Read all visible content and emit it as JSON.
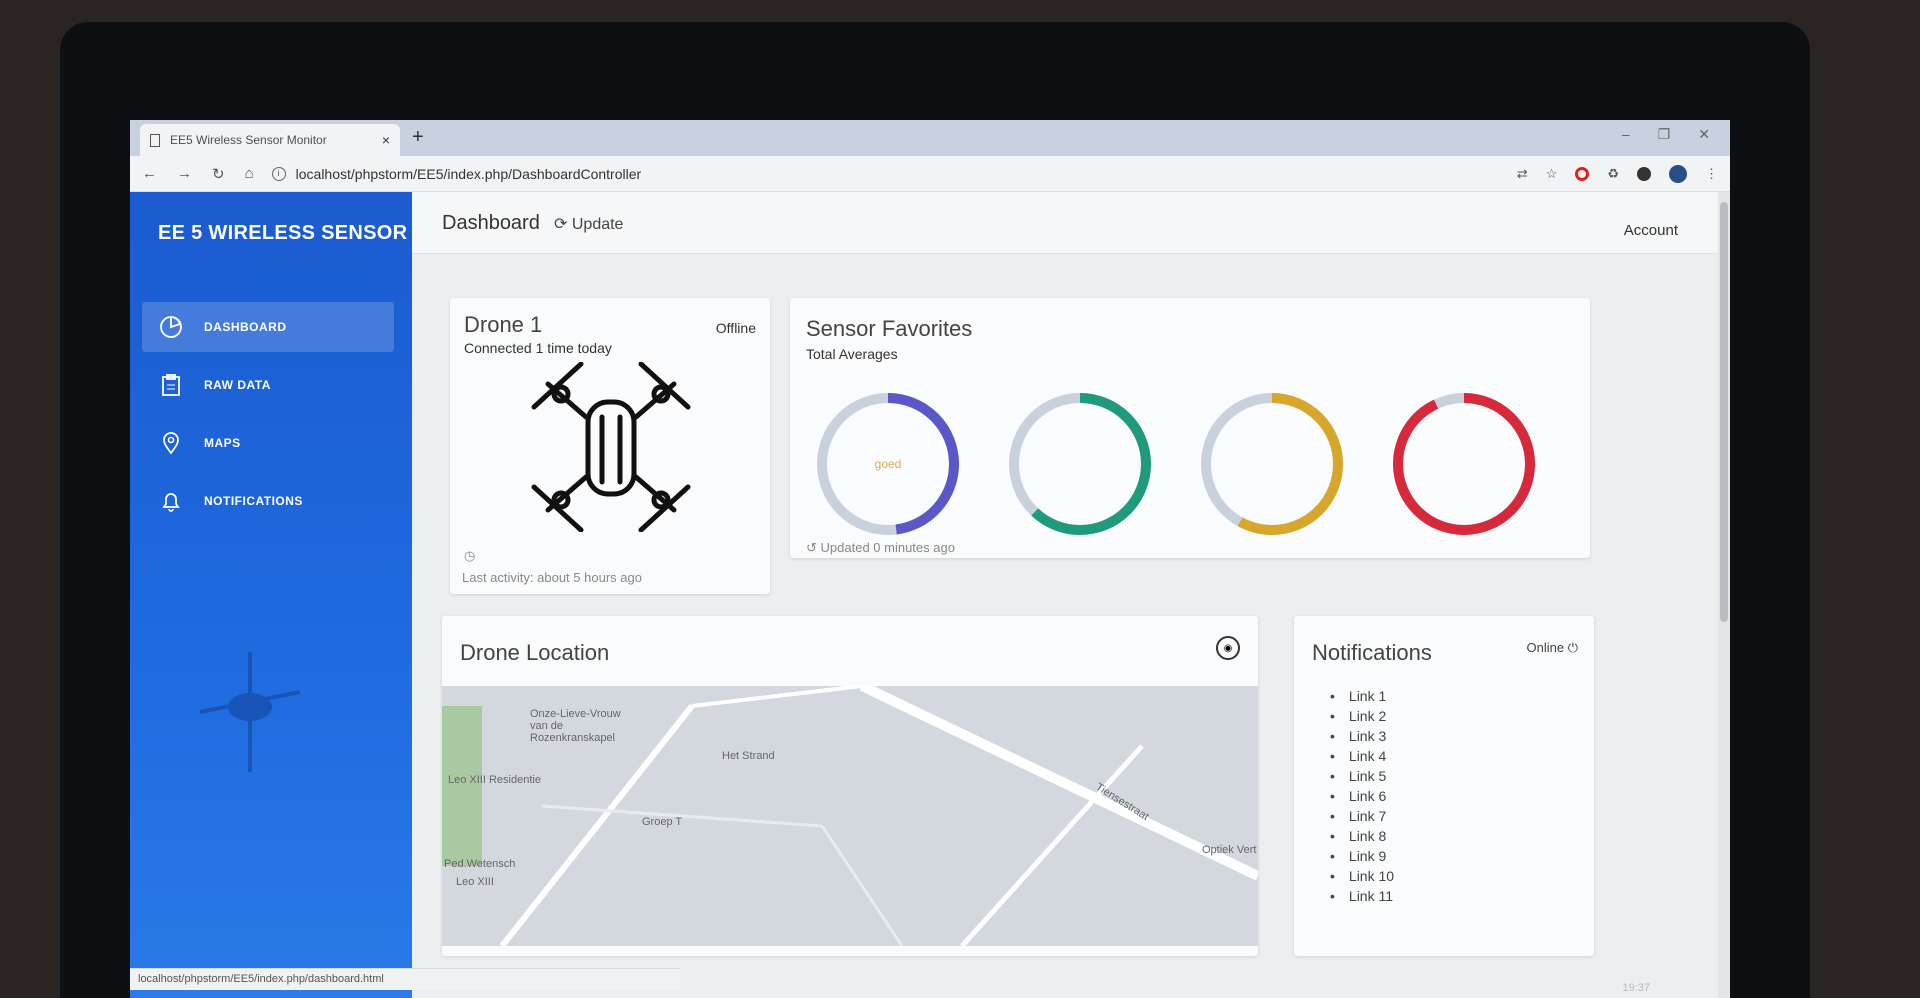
{
  "browser": {
    "tab_title": "EE5 Wireless Sensor Monitor",
    "tab_close": "×",
    "new_tab": "+",
    "url": "localhost/phpstorm/EE5/index.php/DashboardController",
    "status_url": "localhost/phpstorm/EE5/index.php/dashboard.html"
  },
  "sidebar": {
    "brand": "EE 5 WIRELESS SENSOR",
    "items": [
      {
        "label": "DASHBOARD",
        "icon": "dashboard-icon",
        "active": true
      },
      {
        "label": "RAW DATA",
        "icon": "clipboard-icon",
        "active": false
      },
      {
        "label": "MAPS",
        "icon": "map-pin-icon",
        "active": false
      },
      {
        "label": "NOTIFICATIONS",
        "icon": "bell-icon",
        "active": false
      }
    ]
  },
  "header": {
    "title": "Dashboard",
    "update_label": "Update",
    "account_label": "Account"
  },
  "drone_card": {
    "title": "Drone 1",
    "status": "Offline",
    "connected": "Connected 1 time today",
    "last_activity": "Last activity: about 5 hours ago"
  },
  "sensor_card": {
    "title": "Sensor Favorites",
    "subtitle": "Total Averages",
    "updated": "Updated 0 minutes ago",
    "rings": [
      {
        "color": "#5b57c8",
        "fraction": 0.48,
        "center_label": "goed"
      },
      {
        "color": "#1f9a7c",
        "fraction": 0.62,
        "center_label": ""
      },
      {
        "color": "#d6a72a",
        "fraction": 0.58,
        "center_label": ""
      },
      {
        "color": "#d62a3c",
        "fraction": 0.93,
        "center_label": ""
      }
    ]
  },
  "location_card": {
    "title": "Drone Location",
    "map_labels": [
      "Onze-Lieve-Vrouw van de Rozenkranskapel",
      "Het Strand",
      "Leo XIII Residentie",
      "Groep T",
      "Ped.Wetensch",
      "Tiensestraat",
      "Optiek Vert",
      "Leo XIII"
    ]
  },
  "notifications_card": {
    "title": "Notifications",
    "status": "Online",
    "links": [
      "Link 1",
      "Link 2",
      "Link 3",
      "Link 4",
      "Link 5",
      "Link 6",
      "Link 7",
      "Link 8",
      "Link 9",
      "Link 10",
      "Link 11"
    ]
  },
  "taskbar": {
    "time": "19:37"
  }
}
